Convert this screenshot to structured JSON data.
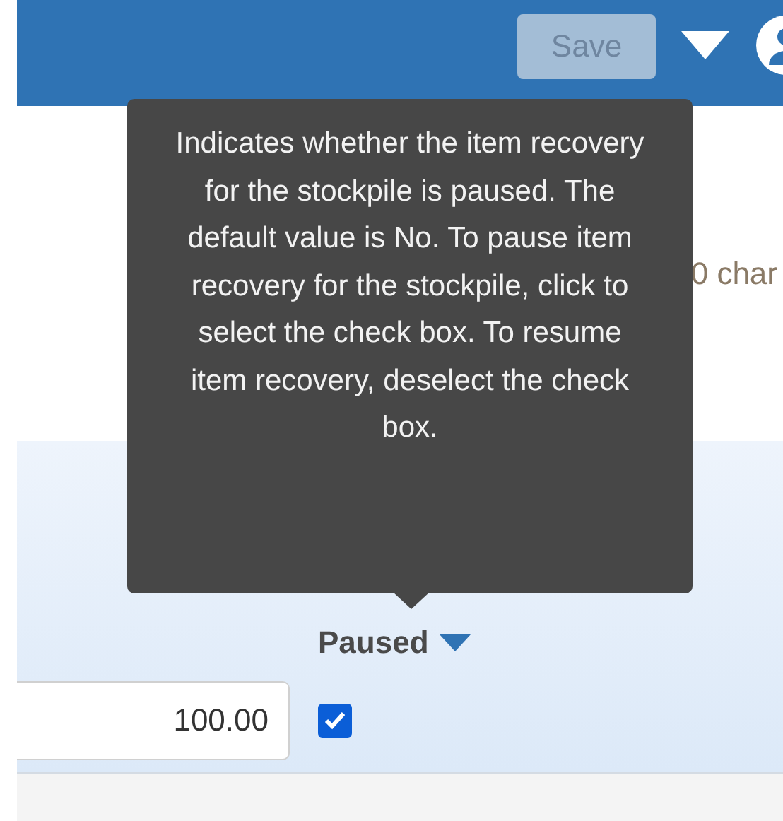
{
  "header": {
    "save_button": {
      "label": "Save",
      "disabled": true
    }
  },
  "status": {
    "text": "0 char"
  },
  "table": {
    "columns": [
      {
        "label": "Paused"
      }
    ],
    "row": {
      "value": "100.00",
      "paused": true
    }
  },
  "tooltip": {
    "text": "Indicates whether the item recovery for the stockpile is paused. The default value is No. To pause item recovery for the stockpile, click to select the check box. To resume item recovery, deselect the check box."
  }
}
